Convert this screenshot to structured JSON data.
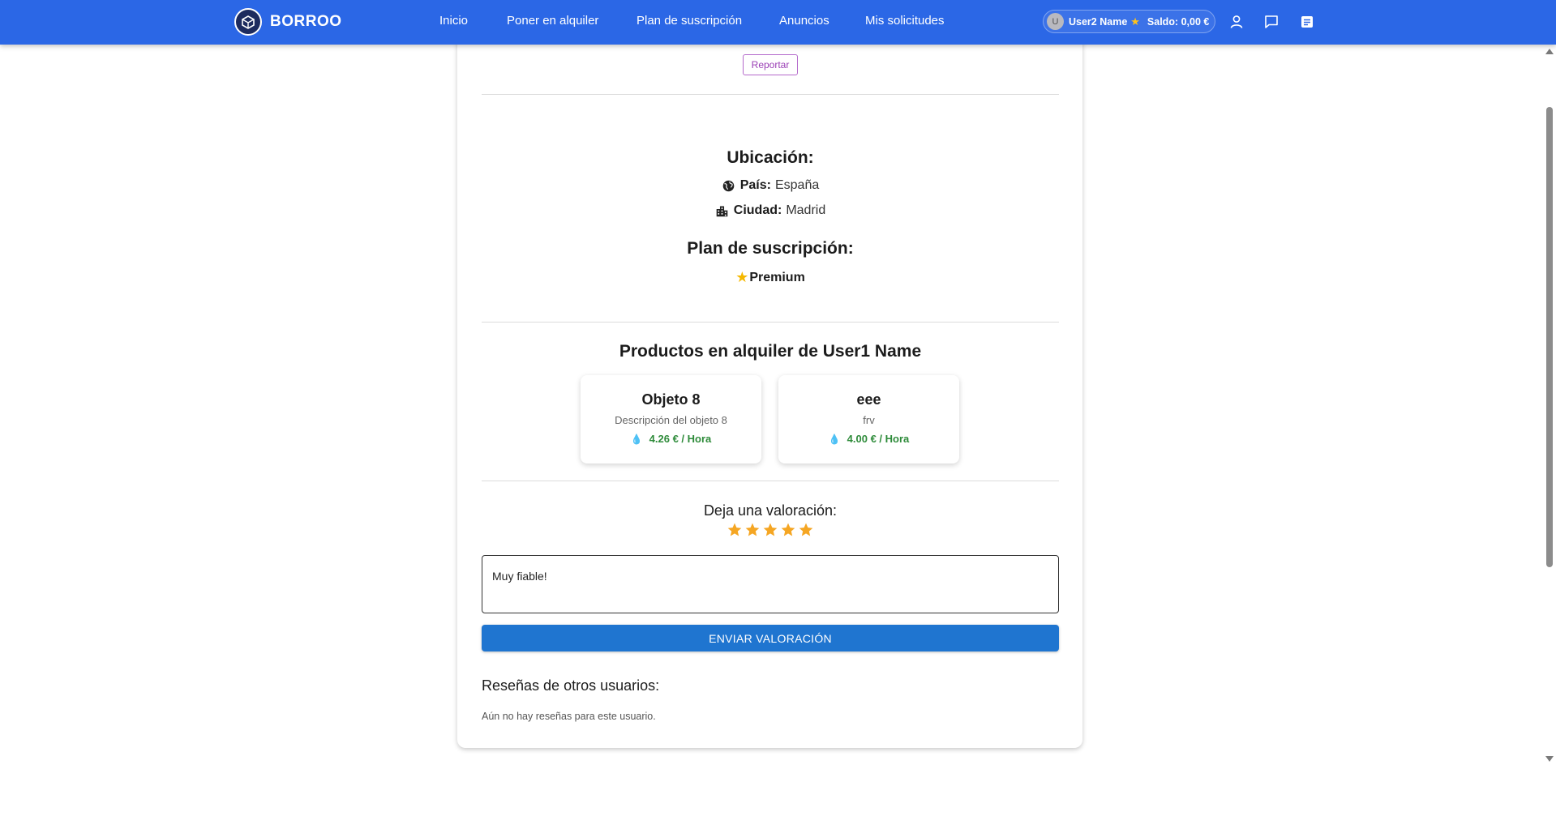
{
  "header": {
    "brand": "BORROO",
    "nav": [
      "Inicio",
      "Poner en alquiler",
      "Plan de suscripción",
      "Anuncios",
      "Mis solicitudes"
    ],
    "user": {
      "avatar_initial": "U",
      "name": "User2 Name",
      "balance": "Saldo: 0,00 €"
    },
    "icons": [
      "user-icon",
      "chat-icon",
      "notes-icon"
    ]
  },
  "profile": {
    "report_label": "Reportar",
    "location": {
      "title": "Ubicación:",
      "country_label": "País:",
      "country": "España",
      "city_label": "Ciudad:",
      "city": "Madrid"
    },
    "subscription": {
      "title": "Plan de suscripción:",
      "plan": "Premium"
    }
  },
  "products": {
    "title": "Productos en alquiler de User1 Name",
    "items": [
      {
        "name": "Objeto 8",
        "description": "Descripción del objeto 8",
        "price": "4.26 € / Hora"
      },
      {
        "name": "eee",
        "description": "frv",
        "price": "4.00 € / Hora"
      }
    ]
  },
  "rating": {
    "title": "Deja una valoración:",
    "stars": 5,
    "comment": "Muy fiable!",
    "submit_label": "ENVIAR VALORACIÓN"
  },
  "reviews": {
    "title": "Reseñas de otros usuarios:",
    "empty": "Aún no hay reseñas para este usuario."
  },
  "colors": {
    "navbar": "#2b67e6",
    "accent": "#1f75d0",
    "star": "#f5a623",
    "price": "#2e8b3a"
  }
}
